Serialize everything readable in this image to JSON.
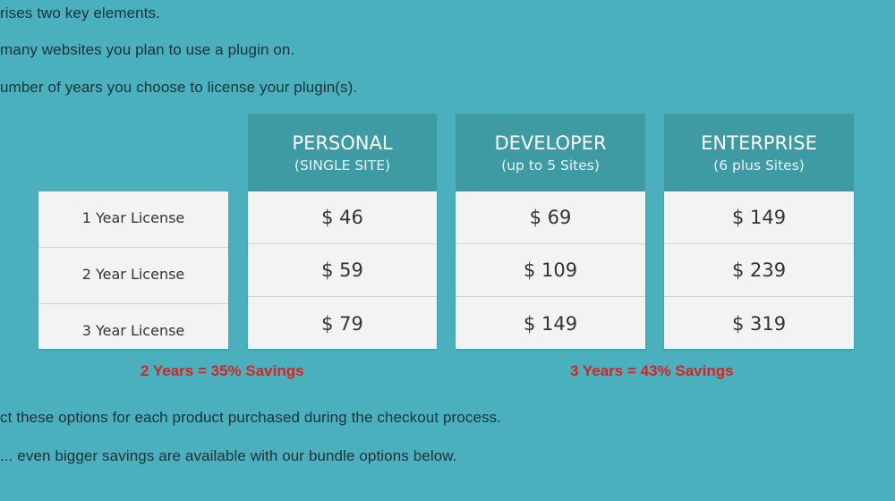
{
  "intro_lines": [
    "rises two key elements.",
    "many websites you plan to use a plugin on.",
    "umber of years you choose to license your plugin(s)."
  ],
  "pricing_table": {
    "row_labels": [
      "1 Year License",
      "2 Year License",
      "3 Year License"
    ],
    "plans": [
      {
        "name": "PERSONAL",
        "subtitle": "(SINGLE SITE)",
        "prices": [
          "$ 46",
          "$ 59",
          "$ 79"
        ]
      },
      {
        "name": "DEVELOPER",
        "subtitle": "(up to 5 Sites)",
        "prices": [
          "$ 69",
          "$ 109",
          "$ 149"
        ]
      },
      {
        "name": "ENTERPRISE",
        "subtitle": "(6 plus Sites)",
        "prices": [
          "$ 149",
          "$ 239",
          "$ 319"
        ]
      }
    ]
  },
  "savings": [
    "2 Years = 35% Savings",
    "3 Years = 43% Savings"
  ],
  "footer_lines": [
    "ct these options for each product purchased during the checkout process.",
    "... even bigger savings are available with our bundle options below."
  ],
  "colors": {
    "background": "#4ab0bd",
    "header": "#3e9ba4",
    "cell": "#f3f3f3",
    "savings_text": "#e0201e"
  }
}
